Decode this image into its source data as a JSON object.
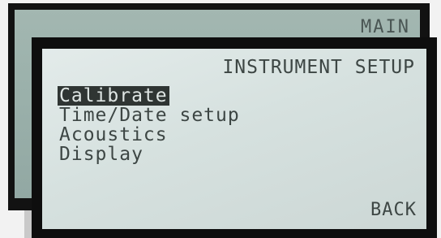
{
  "back_screen": {
    "title": "MAIN"
  },
  "front_screen": {
    "title": "INSTRUMENT SETUP",
    "menu": [
      {
        "label": "Calibrate",
        "selected": true
      },
      {
        "label": "Time/Date setup",
        "selected": false
      },
      {
        "label": "Acoustics",
        "selected": false
      },
      {
        "label": "Display",
        "selected": false
      }
    ],
    "softkey_label": "BACK"
  },
  "colors": {
    "lcd_background": "#d9e3e1",
    "lcd_text": "#3d4644",
    "bezel": "#0e0e0e",
    "highlight": "#2f3533"
  }
}
